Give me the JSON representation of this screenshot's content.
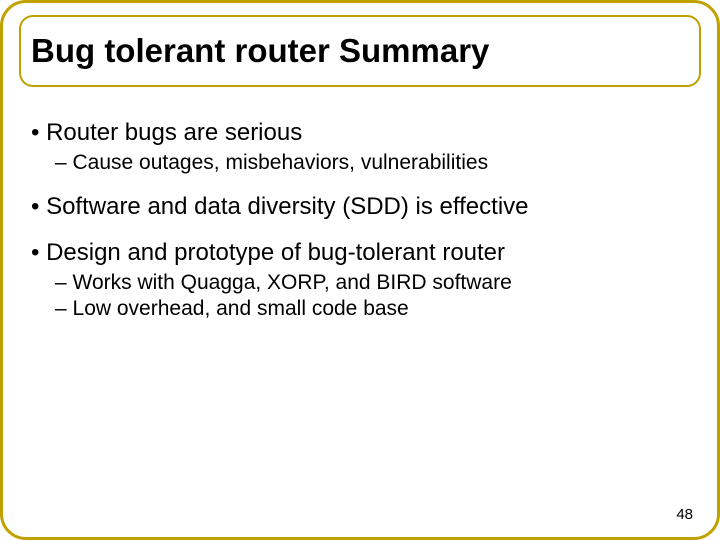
{
  "title": "Bug tolerant router Summary",
  "bullets": {
    "b0": "• Router bugs are serious",
    "b0_sub0": "– Cause outages, misbehaviors, vulnerabilities",
    "b1": "• Software and data diversity (SDD)  is effective",
    "b2": "• Design and prototype of bug-tolerant router",
    "b2_sub0": "– Works with Quagga, XORP, and BIRD software",
    "b2_sub1": "– Low overhead, and small code base"
  },
  "page_number": "48"
}
